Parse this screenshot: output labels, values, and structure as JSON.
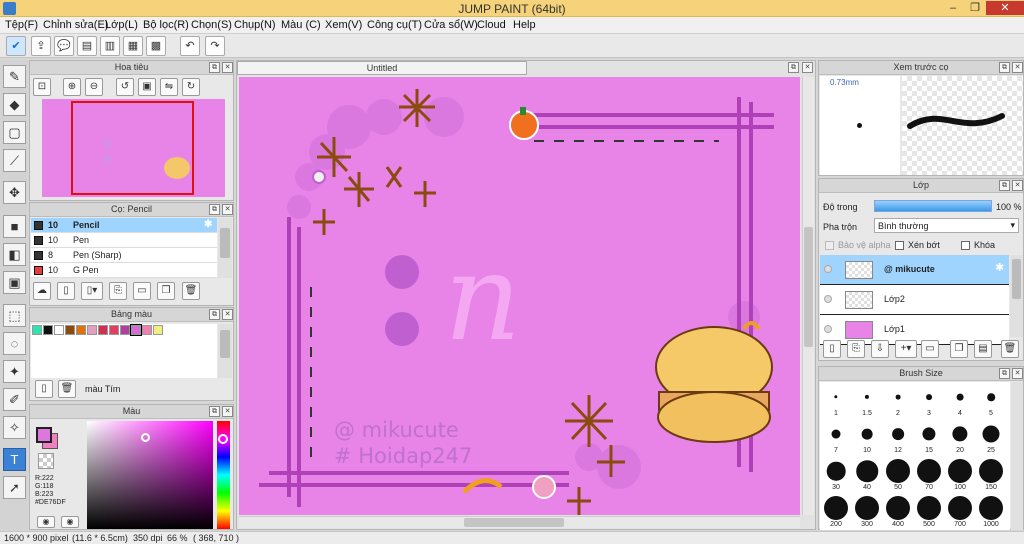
{
  "app": {
    "title": "JUMP PAINT (64bit)"
  },
  "menu": [
    "Tệp(F)",
    "Chỉnh sửa(E)",
    "Lớp(L)",
    "Bộ lọc(R)",
    "Chọn(S)",
    "Chụp(N)",
    "Màu (C)",
    "Xem(V)",
    "Công cụ(T)",
    "Cửa sổ(W)",
    "Cloud",
    "Help"
  ],
  "navigator": {
    "title": "Hoa tiêu"
  },
  "brush_panel": {
    "title": "Cọ: Pencil",
    "items": [
      {
        "size": "10",
        "name": "Pencil",
        "color": "#333333"
      },
      {
        "size": "10",
        "name": "Pen",
        "color": "#333333"
      },
      {
        "size": "8",
        "name": "Pen (Sharp)",
        "color": "#333333"
      },
      {
        "size": "10",
        "name": "G Pen",
        "color": "#e04040"
      }
    ]
  },
  "palette": {
    "title": "Bảng màu",
    "color_name": "màu Tím",
    "swatches": [
      "#33e0b0",
      "#111111",
      "#ffffff",
      "#8a4a10",
      "#e07010",
      "#e0a0c0",
      "#d03050",
      "#e04060",
      "#b040a0",
      "#d070d0",
      "#f080b0",
      "#f0f080"
    ]
  },
  "color_panel": {
    "title": "Màu",
    "r": "R:222",
    "g": "G:118",
    "b": "B:223",
    "hex": "#DE76DF",
    "fg": "#de76df",
    "bg": "#f080c0"
  },
  "document": {
    "tab": "Untitled",
    "watermark_line1": "@ mikucute",
    "watermark_line2": "# Hoidap247",
    "letter": "n"
  },
  "preview": {
    "title": "Xem trước cọ",
    "size": "0.73mm"
  },
  "layers": {
    "title": "Lớp",
    "opacity_label": "Độ trong",
    "opacity_value": "100 %",
    "blend_label": "Pha trộn",
    "blend_value": "Bình thường",
    "protect_alpha": "Bảo vệ alpha",
    "clip": "Xén bớt",
    "lock": "Khóa",
    "items": [
      {
        "name": "@ mikucute",
        "selected": true
      },
      {
        "name": "Lớp2",
        "selected": false
      },
      {
        "name": "Lớp1",
        "selected": false
      }
    ]
  },
  "brush_size": {
    "title": "Brush Size",
    "rows": [
      [
        "1",
        "1.5",
        "2",
        "3",
        "4",
        "5"
      ],
      [
        "7",
        "10",
        "12",
        "15",
        "20",
        "25"
      ],
      [
        "30",
        "40",
        "50",
        "70",
        "100",
        "150"
      ],
      [
        "200",
        "300",
        "400",
        "500",
        "700",
        "1000"
      ]
    ]
  },
  "status": {
    "dims": "1600 * 900 pixel",
    "size_cm": "(11.6 * 6.5cm)",
    "dpi": "350 dpi",
    "zoom": "66 %",
    "coords": "( 368, 710 )"
  }
}
